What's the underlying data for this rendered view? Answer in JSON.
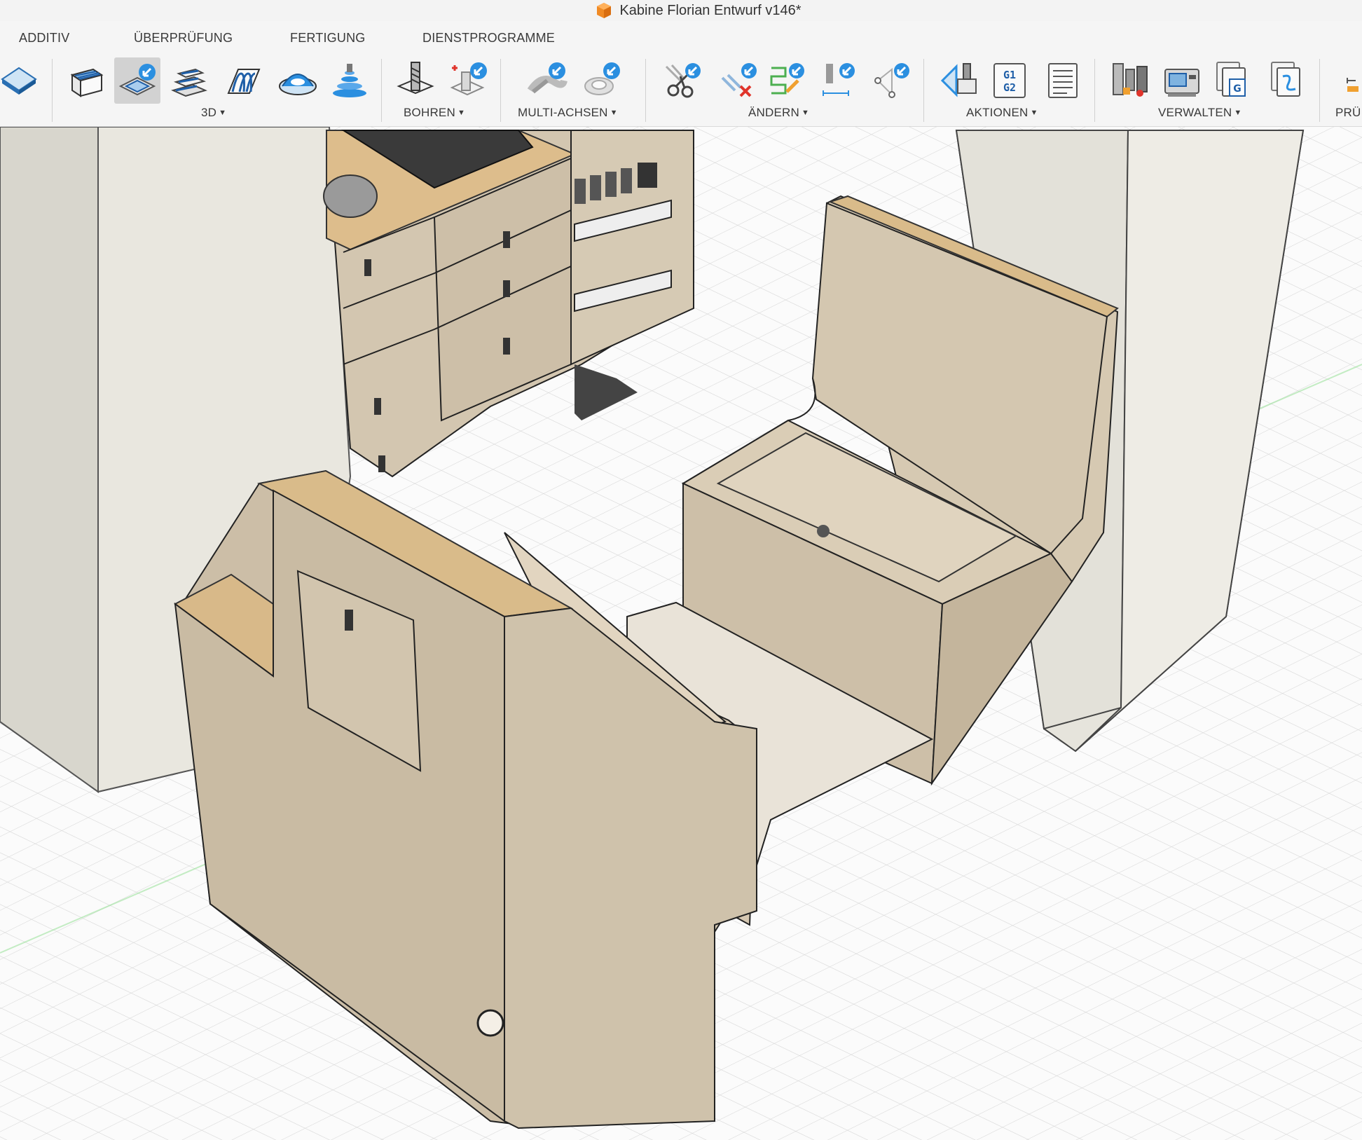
{
  "window": {
    "title": "Kabine Florian Entwurf v146*",
    "app_icon": "orange-cube-icon"
  },
  "tabs": [
    {
      "label": "ADDITIV"
    },
    {
      "label": "ÜBERPRÜFUNG"
    },
    {
      "label": "FERTIGUNG"
    },
    {
      "label": "DIENSTPROGRAMME"
    }
  ],
  "toolbar": {
    "groups": [
      {
        "label": "3D",
        "tools": [
          "face-icon",
          "2d-pocket-icon",
          "adaptive-clearing-icon",
          "parallel-icon",
          "scallop-icon",
          "contour-icon"
        ]
      },
      {
        "label": "BOHREN",
        "tools": [
          "drill-icon",
          "drill-position-icon"
        ]
      },
      {
        "label": "MULTI-ACHSEN",
        "tools": [
          "multiaxis-contour-icon",
          "multiaxis-swarf-icon"
        ]
      },
      {
        "label": "ÄNDERN",
        "tools": [
          "trim-icon",
          "delete-path-icon",
          "edit-path-icon",
          "tool-orientation-icon",
          "points-icon"
        ]
      },
      {
        "label": "AKTIONEN",
        "tools": [
          "simulate-icon",
          "post-process-icon",
          "setup-sheet-icon"
        ]
      },
      {
        "label": "VERWALTEN",
        "tools": [
          "tool-library-icon",
          "machine-library-icon",
          "nc-program-icon",
          "template-library-icon"
        ]
      },
      {
        "label": "PRÜ",
        "tools": [
          "inspect-icon"
        ]
      }
    ],
    "selected_tool": "2d-pocket-icon"
  },
  "viewport": {
    "scene": "3D design view: camper cabin seating module with two benches, kitchen unit and wall panels",
    "colors": {
      "panel": "#cdbfa8",
      "plywood_edge": "#dcc08e",
      "wall": "#e6e4dc",
      "grid_line": "#d8d8d8",
      "grid_axis": "#9fe39f"
    }
  }
}
